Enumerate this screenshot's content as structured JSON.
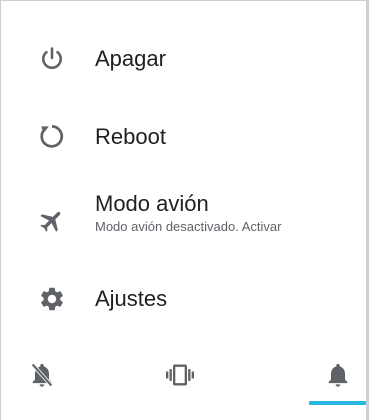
{
  "menu": {
    "items": [
      {
        "label": "Apagar",
        "icon": "power-icon"
      },
      {
        "label": "Reboot",
        "icon": "reboot-icon"
      },
      {
        "label": "Modo avión",
        "sublabel": "Modo avión desactivado. Activar",
        "icon": "airplane-icon"
      },
      {
        "label": "Ajustes",
        "icon": "gear-icon"
      }
    ]
  },
  "sound_modes": {
    "options": [
      {
        "name": "mute",
        "icon": "bell-off-icon"
      },
      {
        "name": "vibrate",
        "icon": "vibrate-icon"
      },
      {
        "name": "ring",
        "icon": "bell-icon"
      }
    ],
    "selected": "ring",
    "accent_color": "#29b6e3",
    "icon_color": "#5f6368"
  }
}
